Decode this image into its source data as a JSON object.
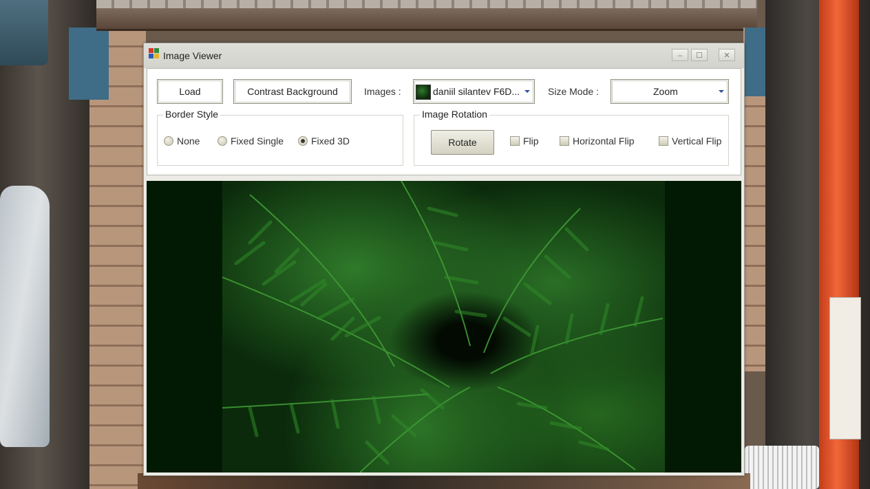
{
  "window": {
    "title": "Image Viewer",
    "minimize": "–",
    "maximize": "☐",
    "close": "✕"
  },
  "toolbar": {
    "load_label": "Load",
    "contrast_label": "Contrast Background",
    "images_label": "Images :",
    "images_selected": "daniil silantev F6D...",
    "size_mode_label": "Size Mode :",
    "size_mode_selected": "Zoom"
  },
  "border_style": {
    "legend": "Border Style",
    "options": [
      {
        "label": "None",
        "selected": false
      },
      {
        "label": "Fixed Single",
        "selected": false
      },
      {
        "label": "Fixed 3D",
        "selected": true
      }
    ]
  },
  "image_rotation": {
    "legend": "Image Rotation",
    "rotate_label": "Rotate",
    "checks": [
      {
        "label": "Flip",
        "checked": false
      },
      {
        "label": "Horizontal Flip",
        "checked": false
      },
      {
        "label": "Vertical Flip",
        "checked": false
      }
    ]
  },
  "picture": {
    "icon": "fern-leaves-photo",
    "background_color": "#021a04"
  }
}
